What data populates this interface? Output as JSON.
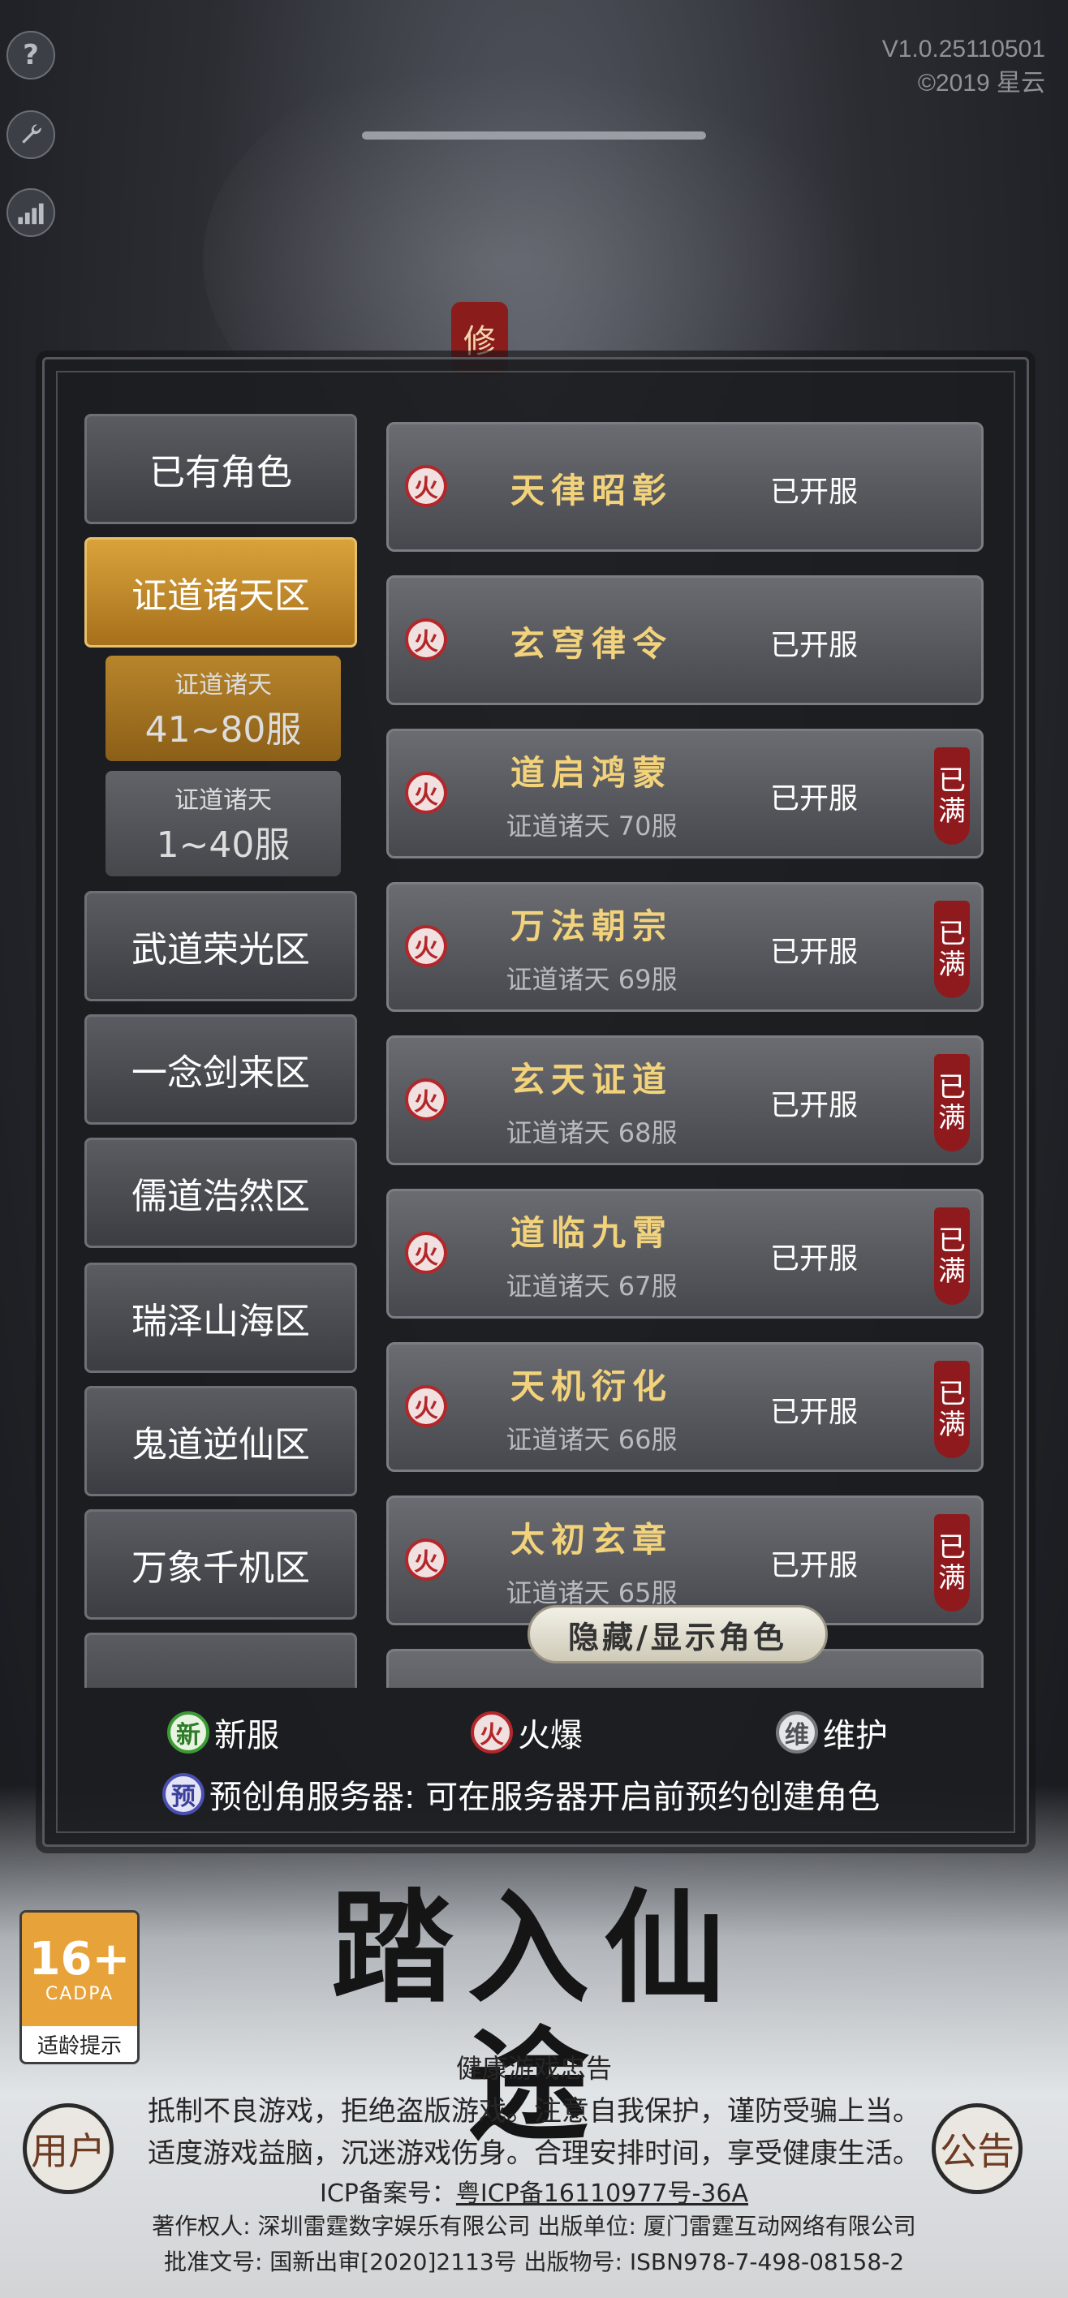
{
  "version": {
    "line1": "V1.0.25110501",
    "line2": "©2019 星云"
  },
  "side_icons": [
    {
      "icon": "help-icon",
      "glyph": "?"
    },
    {
      "icon": "wrench-icon",
      "glyph": "🔧"
    },
    {
      "icon": "signal-icon",
      "glyph": "▮"
    }
  ],
  "title_seal": "修",
  "categories": [
    {
      "label": "已有角色",
      "active": false
    },
    {
      "label": "证道诸天区",
      "active": true
    },
    {
      "label": "武道荣光区",
      "active": false
    },
    {
      "label": "一念剑来区",
      "active": false
    },
    {
      "label": "儒道浩然区",
      "active": false
    },
    {
      "label": "瑞泽山海区",
      "active": false
    },
    {
      "label": "鬼道逆仙区",
      "active": false
    },
    {
      "label": "万象千机区",
      "active": false
    }
  ],
  "sub_ranges": [
    {
      "line1": "证道诸天",
      "line2": "41~80服",
      "active": true
    },
    {
      "line1": "证道诸天",
      "line2": "1~40服",
      "active": false
    }
  ],
  "servers": [
    {
      "name": "天律昭彰",
      "sub": "",
      "status": "已开服",
      "full": false,
      "tag": "火"
    },
    {
      "name": "玄穹律令",
      "sub": "",
      "status": "已开服",
      "full": false,
      "tag": "火"
    },
    {
      "name": "道启鸿蒙",
      "sub": "证道诸天 70服",
      "status": "已开服",
      "full": true,
      "tag": "火"
    },
    {
      "name": "万法朝宗",
      "sub": "证道诸天 69服",
      "status": "已开服",
      "full": true,
      "tag": "火"
    },
    {
      "name": "玄天证道",
      "sub": "证道诸天 68服",
      "status": "已开服",
      "full": true,
      "tag": "火"
    },
    {
      "name": "道临九霄",
      "sub": "证道诸天 67服",
      "status": "已开服",
      "full": true,
      "tag": "火"
    },
    {
      "name": "天机衍化",
      "sub": "证道诸天 66服",
      "status": "已开服",
      "full": true,
      "tag": "火"
    },
    {
      "name": "太初玄章",
      "sub": "证道诸天 65服",
      "status": "已开服",
      "full": true,
      "tag": "火"
    }
  ],
  "full_tag": {
    "c1": "已",
    "c2": "满"
  },
  "toggle_label": "隐藏/显示角色",
  "legend": {
    "new": {
      "glyph": "新",
      "label": "新服"
    },
    "hot": {
      "glyph": "火",
      "label": "火爆"
    },
    "maint": {
      "glyph": "维",
      "label": "维护"
    },
    "pre": {
      "glyph": "预",
      "label": "预创角服务器: 可在服务器开启前预约创建角色"
    }
  },
  "age": {
    "rating": "16+",
    "org": "CADPA",
    "caption": "适龄提示"
  },
  "enter_title": "踏入仙途",
  "corner_left": "用户",
  "corner_right": "公告",
  "notice": {
    "heading": "健康游戏忠告",
    "line1": "抵制不良游戏，拒绝盗版游戏。注意自我保护，谨防受骗上当。",
    "line2": "适度游戏益脑，沉迷游戏伤身。合理安排时间，享受健康生活。",
    "icp_label": "ICP备案号：",
    "icp_value": "粤ICP备16110977号-36A",
    "copyright": "著作权人: 深圳雷霆数字娱乐有限公司 出版单位: 厦门雷霆互动网络有限公司",
    "approval": "批准文号: 国新出审[2020]2113号 出版物号: ISBN978-7-498-08158-2"
  },
  "colors": {
    "accent_gold": "#d9a23b",
    "server_name": "#f2d27a",
    "hot_red": "#b3262a",
    "full_red": "#8e1a1e"
  }
}
